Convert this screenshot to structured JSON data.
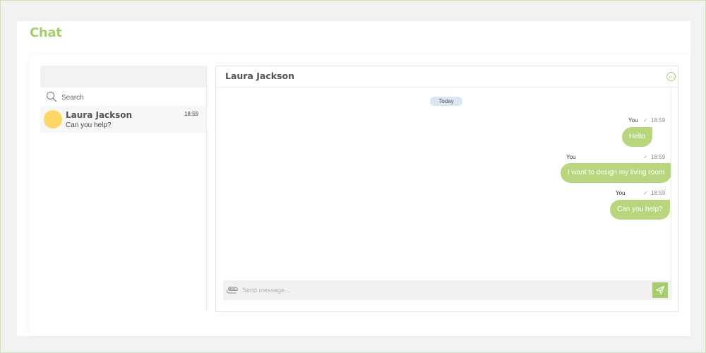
{
  "page": {
    "title": "Chat"
  },
  "colors": {
    "accent": "#a6cc6e",
    "bubble": "#b8d67e",
    "avatar": "#fdd663",
    "day_pill": "#dbe5f5",
    "panel_header": "#f2f2f2"
  },
  "sidebar": {
    "search": {
      "placeholder": "Search",
      "icon": "search-icon"
    },
    "contacts": [
      {
        "name": "Laura Jackson",
        "preview": "Can you help?",
        "time": "18:59",
        "avatar_color": "#fdd663"
      }
    ]
  },
  "conversation": {
    "title": "Laura Jackson",
    "menu_icon": "more-icon",
    "day_label": "Today",
    "messages": [
      {
        "sender": "You",
        "time": "18:59",
        "status_icon": "check-icon",
        "text": "Hello"
      },
      {
        "sender": "You",
        "time": "18:59",
        "status_icon": "check-icon",
        "text": "I want to design my living room"
      },
      {
        "sender": "You",
        "time": "18:59",
        "status_icon": "check-icon",
        "text": "Can you help?"
      }
    ],
    "composer": {
      "placeholder": "Send message...",
      "attach_icon": "paperclip-icon",
      "send_icon": "send-icon"
    }
  }
}
